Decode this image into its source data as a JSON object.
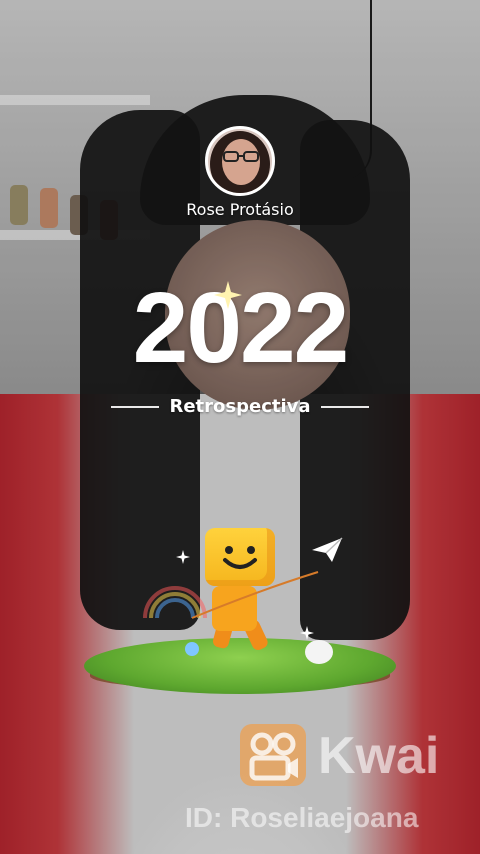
{
  "profile": {
    "name": "Rose Protásio"
  },
  "headline": {
    "year": "2022",
    "subtitle": "Retrospectiva"
  },
  "watermark": {
    "brand": "Kwai",
    "id": "ID: Roseliaejoana"
  },
  "icons": [
    "sparkle-icon",
    "paper-plane-icon",
    "kwai-logo-icon"
  ],
  "colors": {
    "text": "#ffffff",
    "kwai_orange": "#ff9628",
    "mascot_yellow": "#ffd23c",
    "grass": "#5ea82f"
  }
}
